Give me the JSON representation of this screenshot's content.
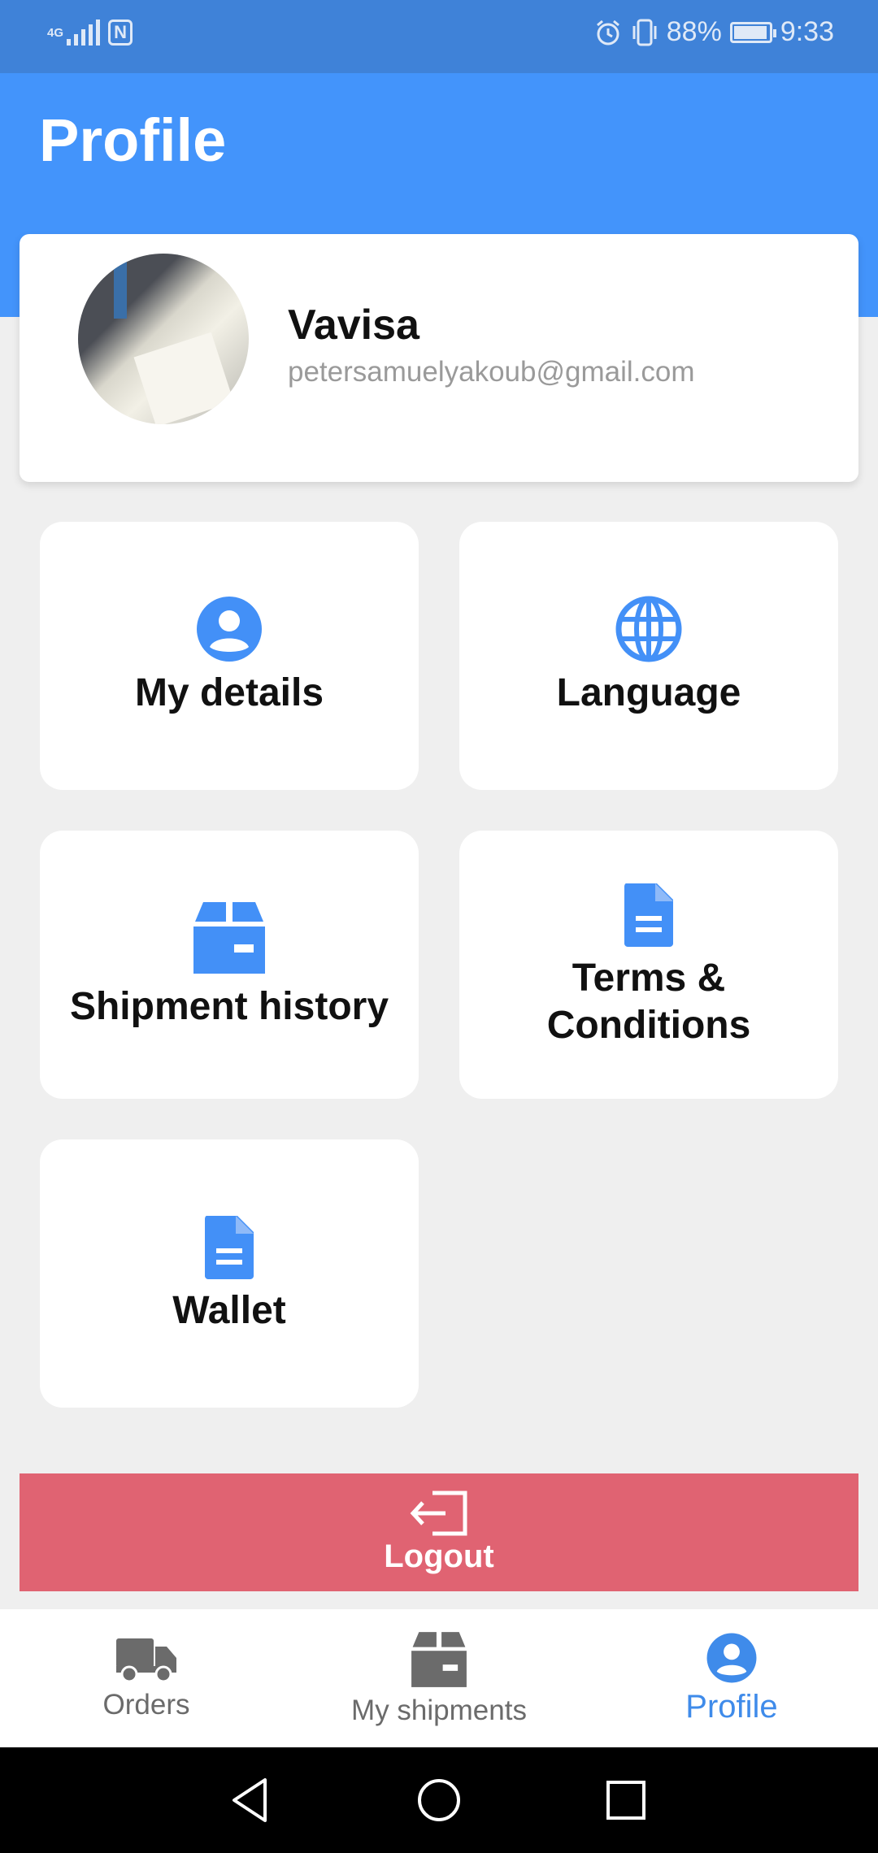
{
  "status_bar": {
    "network": "4G",
    "battery_percent": "88%",
    "time": "9:33",
    "battery_level": 0.88,
    "nfc": "N"
  },
  "header": {
    "title": "Profile"
  },
  "profile": {
    "name": "Vavisa",
    "email": "petersamuelyakoub@gmail.com"
  },
  "tiles": [
    {
      "label": "My details",
      "icon": "user-icon"
    },
    {
      "label": "Language",
      "icon": "globe-icon"
    },
    {
      "label": "Shipment history",
      "icon": "package-icon"
    },
    {
      "label": "Terms &\nConditions",
      "icon": "document-icon"
    },
    {
      "label": "Wallet",
      "icon": "document-icon"
    }
  ],
  "logout": {
    "label": "Logout",
    "icon": "logout-icon"
  },
  "bottom_nav": {
    "items": [
      {
        "label": "Orders",
        "icon": "truck-icon"
      },
      {
        "label": "My shipments",
        "icon": "package-icon"
      },
      {
        "label": "Profile",
        "icon": "user-icon",
        "active": true
      }
    ]
  },
  "colors": {
    "primary": "#4394fb",
    "status_bar": "#3f82d8",
    "logout": "#e06372",
    "icon_blue": "#4390f7",
    "nav_inactive": "#6b6b6b",
    "nav_active": "#3f8bea"
  }
}
